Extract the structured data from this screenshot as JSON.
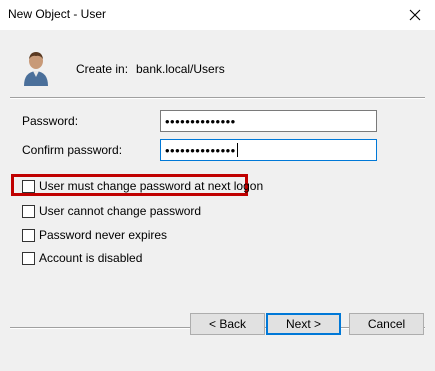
{
  "window": {
    "title": "New Object - User"
  },
  "header": {
    "create_in_label": "Create in:",
    "create_in_value": "bank.local/Users"
  },
  "fields": {
    "password_label": "Password:",
    "password_value": "••••••••••••••",
    "confirm_label": "Confirm password:",
    "confirm_value": "••••••••••••••"
  },
  "options": [
    {
      "label": "User must change password at next logon",
      "checked": false
    },
    {
      "label": "User cannot change password",
      "checked": false
    },
    {
      "label": "Password never expires",
      "checked": false
    },
    {
      "label": "Account is disabled",
      "checked": false
    }
  ],
  "buttons": {
    "back": "< Back",
    "next": "Next >",
    "cancel": "Cancel"
  },
  "colors": {
    "highlight": "#c00000",
    "focus": "#0078d7"
  },
  "icons": {
    "close": "close-icon",
    "user": "user-icon"
  }
}
